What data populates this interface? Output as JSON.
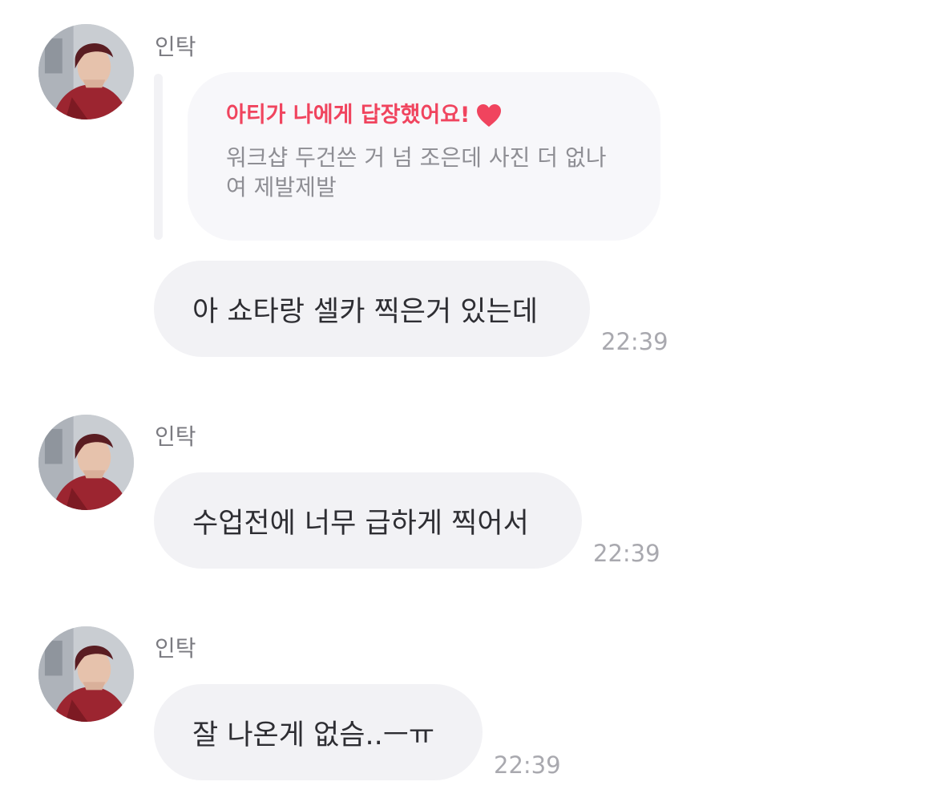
{
  "messages": [
    {
      "sender": "인탁",
      "reply": {
        "title": "아티가 나에게 답장했어요!",
        "icon": "heart-icon",
        "text": "워크샵 두건쓴 거 넘 조은데 사진 더 없나여 제발제발"
      },
      "text": "아 쇼타랑 셀카 찍은거 있는데",
      "time": "22:39"
    },
    {
      "sender": "인탁",
      "text": "수업전에 너무 급하게 찍어서",
      "time": "22:39"
    },
    {
      "sender": "인탁",
      "text": "잘 나온게 없슴..ㅡㅠ",
      "time": "22:39"
    }
  ],
  "colors": {
    "accent": "#f0445e",
    "bubble": "#f2f2f5",
    "reply_card": "#f7f7fa",
    "sender": "#7a7a80",
    "time": "#a9a9af"
  }
}
